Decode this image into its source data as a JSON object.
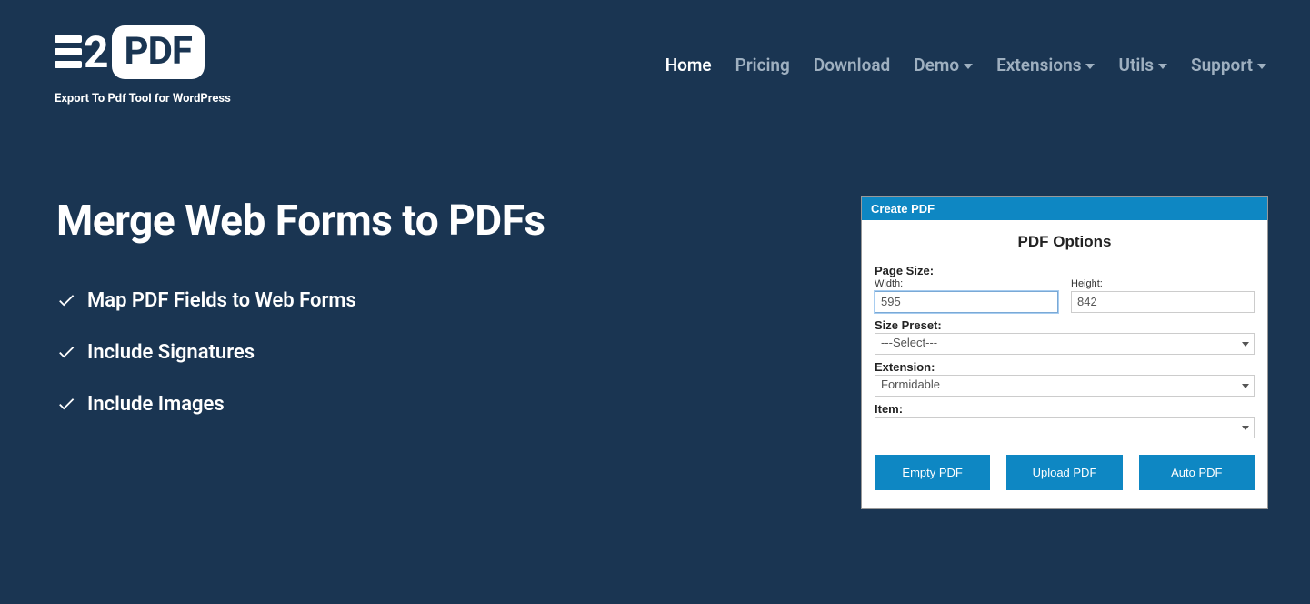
{
  "logo": {
    "two": "2",
    "pdf": "PDF",
    "tagline": "Export To Pdf Tool for WordPress"
  },
  "nav": {
    "home": "Home",
    "pricing": "Pricing",
    "download": "Download",
    "demo": "Demo",
    "extensions": "Extensions",
    "utils": "Utils",
    "support": "Support"
  },
  "hero": {
    "title": "Merge Web Forms to PDFs",
    "features": {
      "f1": "Map PDF Fields to Web Forms",
      "f2": "Include Signatures",
      "f3": "Include Images"
    }
  },
  "panel": {
    "header": "Create PDF",
    "title": "PDF Options",
    "page_size_label": "Page Size:",
    "width_label": "Width:",
    "width_value": "595",
    "height_label": "Height:",
    "height_value": "842",
    "size_preset_label": "Size Preset:",
    "size_preset_value": "---Select---",
    "extension_label": "Extension:",
    "extension_value": "Formidable",
    "item_label": "Item:",
    "item_value": "",
    "buttons": {
      "empty": "Empty PDF",
      "upload": "Upload PDF",
      "auto": "Auto PDF"
    }
  }
}
